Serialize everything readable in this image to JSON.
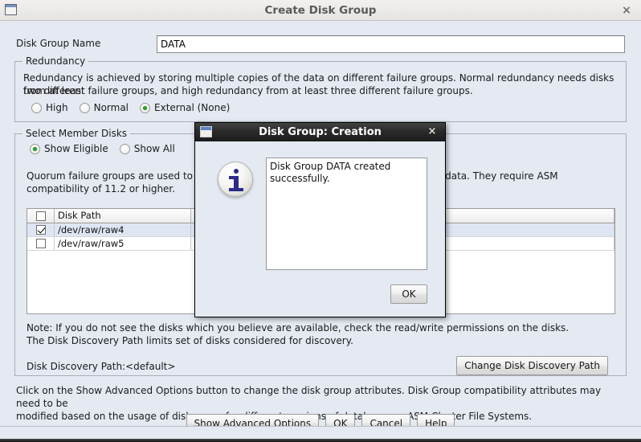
{
  "window": {
    "title": "Create Disk Group",
    "icon": "window-icon",
    "close_label": "×"
  },
  "form": {
    "disk_group_name_label": "Disk Group Name",
    "disk_group_name_value": "DATA",
    "disk_group_name_placeholder": ""
  },
  "redundancy": {
    "legend": "Redundancy",
    "description_line1": "Redundancy is achieved by storing multiple copies of the data on different failure groups. Normal redundancy needs disks from at least",
    "description_line2": "two different failure groups, and high redundancy from at least three different failure groups.",
    "options": [
      {
        "label": "High",
        "selected": false
      },
      {
        "label": "Normal",
        "selected": false
      },
      {
        "label": "External (None)",
        "selected": true
      }
    ]
  },
  "member_disks": {
    "legend": "Select Member Disks",
    "filter_options": [
      {
        "label": "Show Eligible",
        "selected": true
      },
      {
        "label": "Show All",
        "selected": false
      }
    ],
    "quorum_line1": "Quorum failure groups are used to store voting files and they cannot contain any user data. They require ASM",
    "quorum_line2": "compatibility of 11.2 or higher.",
    "table": {
      "columns": [
        "",
        "Disk Path"
      ],
      "header_checkbox_checked": false,
      "rows": [
        {
          "checked": true,
          "disk_path": "/dev/raw/raw4",
          "selected": true
        },
        {
          "checked": false,
          "disk_path": "/dev/raw/raw5",
          "selected": false
        }
      ]
    },
    "note_line1": "Note: If you do not see the disks which you believe are available, check the read/write permissions on the disks.",
    "note_line2": "The Disk Discovery Path limits set of disks considered for discovery.",
    "discovery_path_text": "Disk Discovery Path:<default>",
    "change_path_button": "Change Disk Discovery Path"
  },
  "footer": {
    "note_line1": "Click on the Show Advanced Options button to change the disk group attributes. Disk Group compatibility attributes may need to be",
    "note_line2": "modified based on the usage of disk group for different versions of databases or ASM Cluster File Systems.",
    "buttons": [
      {
        "label": "Show Advanced Options",
        "name": "show-advanced-options-button"
      },
      {
        "label": "OK",
        "name": "ok-button"
      },
      {
        "label": "Cancel",
        "name": "cancel-button"
      },
      {
        "label": "Help",
        "name": "help-button"
      }
    ]
  },
  "modal": {
    "title": "Disk Group: Creation",
    "close_label": "×",
    "icon": "info-icon",
    "message": "Disk Group DATA created successfully.",
    "ok_label": "OK"
  },
  "colors": {
    "window_background": "#e4e9f2",
    "titlebar": "#eceae6",
    "modal_titlebar": "#1b1b1b",
    "radio_selected": "#2f9e2f",
    "info_blue": "#2b2b88",
    "row_selected": "#dfe6f3"
  }
}
